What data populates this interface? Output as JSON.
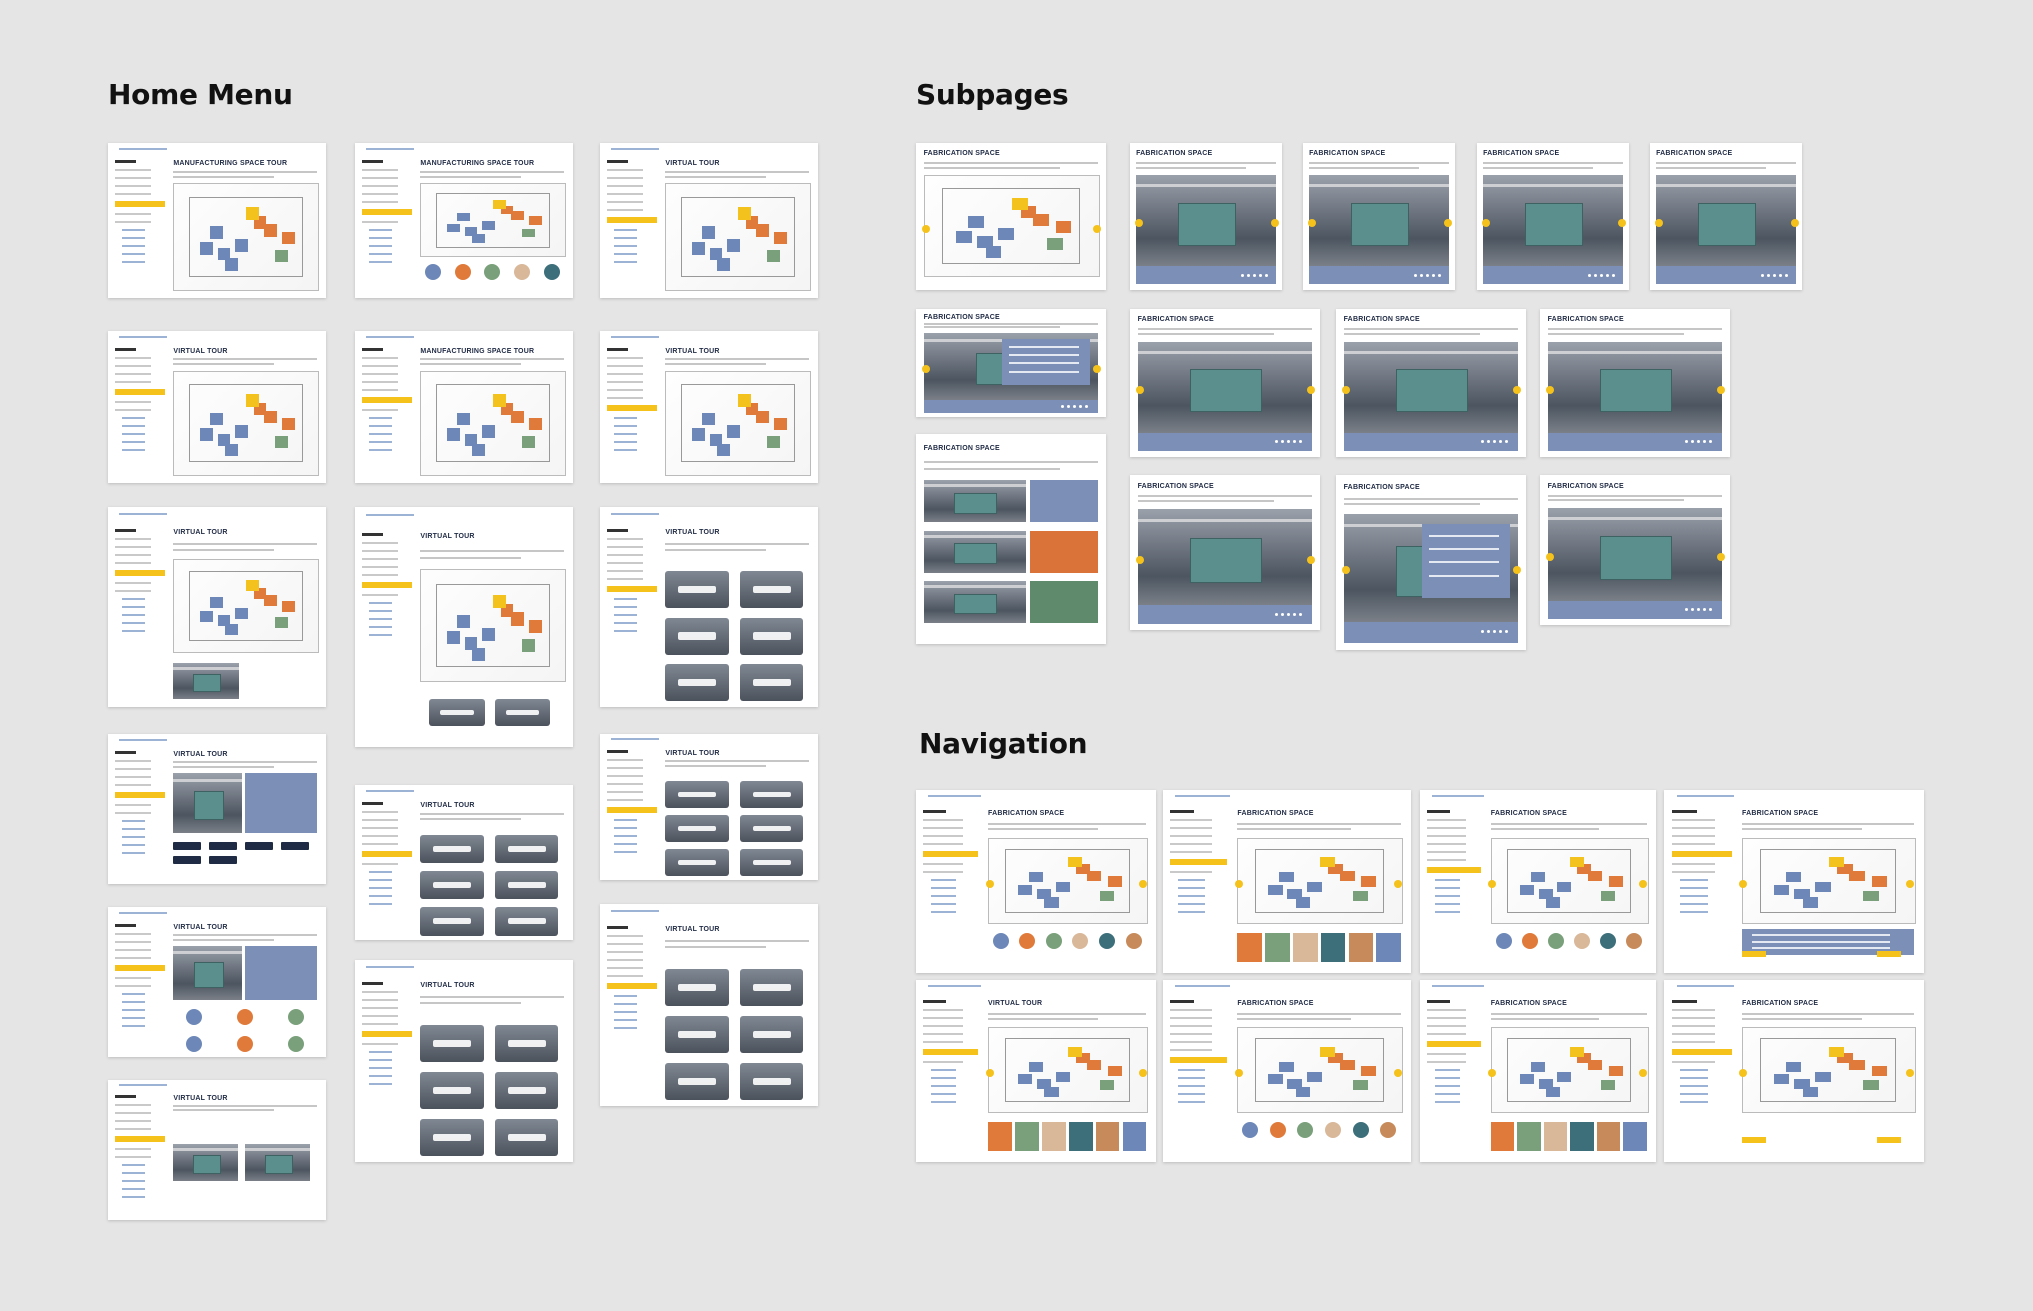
{
  "sections": {
    "home_menu": "Home Menu",
    "subpages": "Subpages",
    "navigation": "Navigation"
  },
  "page_titles": {
    "manufacturing_space_tour": "MANUFACTURING SPACE TOUR",
    "virtual_tour": "VIRTUAL TOUR",
    "fabrication_space": "FABRICATION SPACE"
  },
  "colors": {
    "background": "#e5e5e5",
    "accent_yellow": "#f5c21b",
    "brand_navy": "#1f2a44",
    "panel_blue": "#7c8fb7"
  },
  "home_menu_frames": [
    {
      "title": "MANUFACTURING SPACE TOUR",
      "content": "floor-plan"
    },
    {
      "title": "MANUFACTURING SPACE TOUR",
      "content": "floor-plan-circles"
    },
    {
      "title": "VIRTUAL TOUR",
      "content": "floor-plan"
    },
    {
      "title": "VIRTUAL TOUR",
      "content": "floor-plan"
    },
    {
      "title": "MANUFACTURING SPACE TOUR",
      "content": "floor-plan"
    },
    {
      "title": "VIRTUAL TOUR",
      "content": "floor-plan"
    },
    {
      "title": "VIRTUAL TOUR",
      "content": "floor-plan-photo"
    },
    {
      "title": "VIRTUAL TOUR",
      "content": "floor-plan-tiles"
    },
    {
      "title": "VIRTUAL TOUR",
      "content": "tiles"
    },
    {
      "title": "VIRTUAL TOUR",
      "content": "photo-buttons"
    },
    {
      "title": "VIRTUAL TOUR",
      "content": "tiles"
    },
    {
      "title": "VIRTUAL TOUR",
      "content": "tiles"
    },
    {
      "title": "VIRTUAL TOUR",
      "content": "photo-circles"
    },
    {
      "title": "VIRTUAL TOUR",
      "content": "tiles"
    },
    {
      "title": "VIRTUAL TOUR",
      "content": "tiles"
    },
    {
      "title": "VIRTUAL TOUR",
      "content": "photo-strip"
    }
  ],
  "subpage_frames": [
    {
      "title": "FABRICATION SPACE",
      "content": "floor-plan"
    },
    {
      "title": "FABRICATION SPACE",
      "content": "photo"
    },
    {
      "title": "FABRICATION SPACE",
      "content": "photo"
    },
    {
      "title": "FABRICATION SPACE",
      "content": "photo"
    },
    {
      "title": "FABRICATION SPACE",
      "content": "photo"
    },
    {
      "title": "FABRICATION SPACE",
      "content": "photo-panel"
    },
    {
      "title": "FABRICATION SPACE",
      "content": "photo"
    },
    {
      "title": "FABRICATION SPACE",
      "content": "photo"
    },
    {
      "title": "FABRICATION SPACE",
      "content": "photo"
    },
    {
      "title": "FABRICATION SPACE",
      "content": "photo-stack"
    },
    {
      "title": "FABRICATION SPACE",
      "content": "photo"
    },
    {
      "title": "FABRICATION SPACE",
      "content": "photo-panel"
    },
    {
      "title": "FABRICATION SPACE",
      "content": "photo"
    }
  ],
  "navigation_frames": [
    {
      "title": "FABRICATION SPACE",
      "content": "floor-plan-circles"
    },
    {
      "title": "FABRICATION SPACE",
      "content": "floor-plan-swatches"
    },
    {
      "title": "FABRICATION SPACE",
      "content": "floor-plan-circles"
    },
    {
      "title": "FABRICATION SPACE",
      "content": "floor-plan-panel"
    },
    {
      "title": "VIRTUAL TOUR",
      "content": "floor-plan-swatches"
    },
    {
      "title": "FABRICATION SPACE",
      "content": "floor-plan-circles"
    },
    {
      "title": "FABRICATION SPACE",
      "content": "floor-plan-swatches"
    },
    {
      "title": "FABRICATION SPACE",
      "content": "floor-plan-buttons"
    }
  ]
}
